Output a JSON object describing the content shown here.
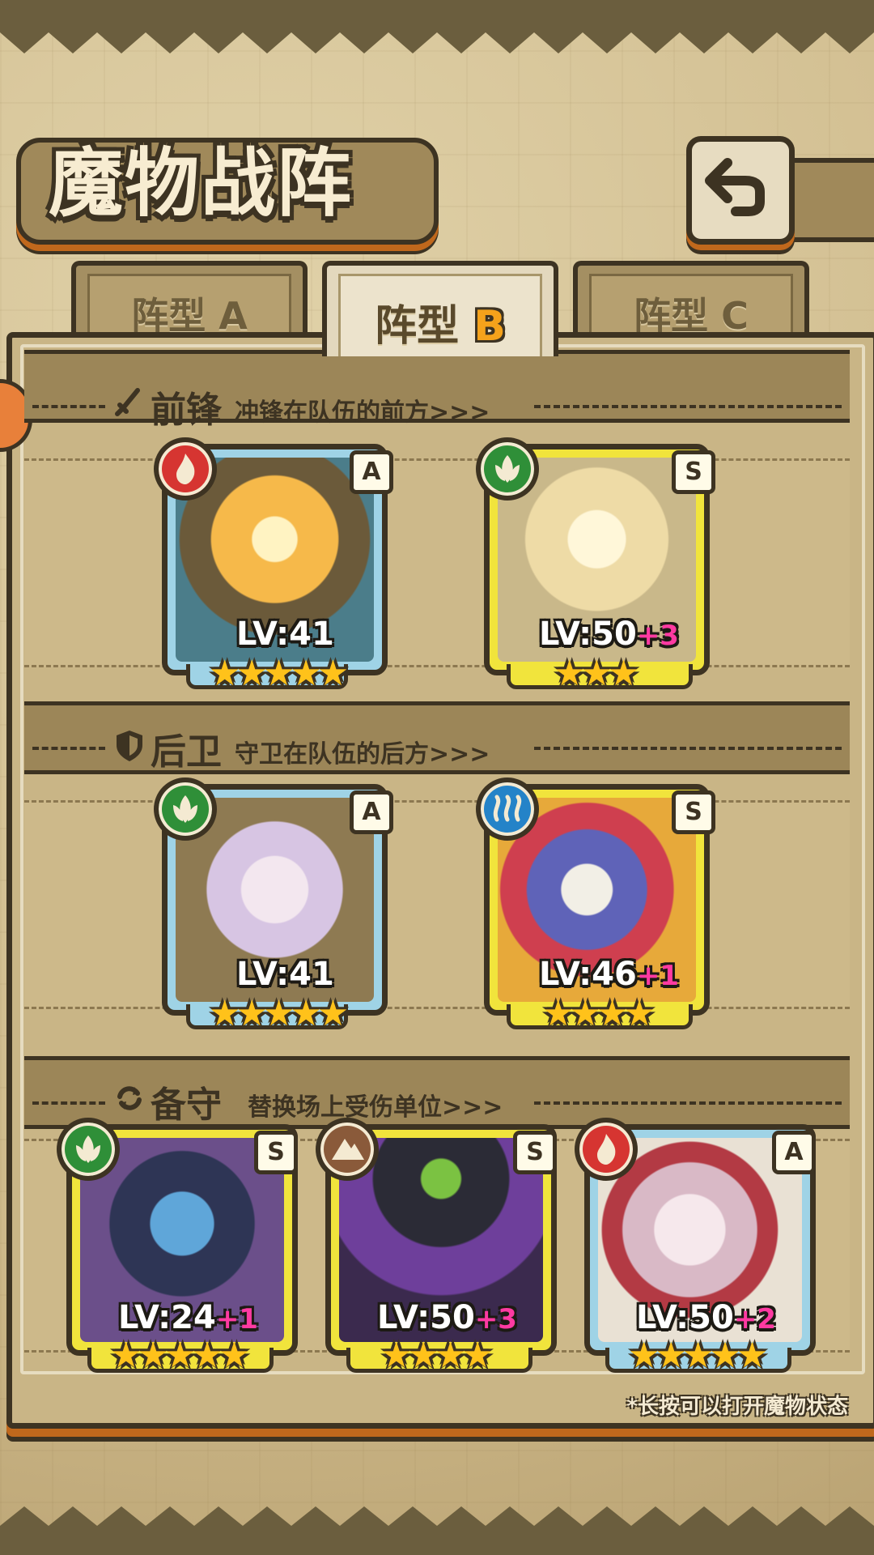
{
  "header": {
    "title": "魔物战阵"
  },
  "tabs": [
    {
      "label": "阵型",
      "letter": "A",
      "active": false
    },
    {
      "label": "阵型",
      "letter": "B",
      "active": true
    },
    {
      "label": "阵型",
      "letter": "C",
      "active": false
    }
  ],
  "sections": {
    "vanguard": {
      "title": "前锋",
      "subtitle": "冲锋在队伍的前方>>>"
    },
    "rearguard": {
      "title": "后卫",
      "subtitle": "守卫在队伍的后方>>>"
    },
    "reserve": {
      "title": "备守",
      "subtitle": "替换场上受伤单位>>>"
    }
  },
  "cards": {
    "v1": {
      "rank": "A",
      "element": "fire",
      "lv": "LV:41",
      "plus": "",
      "stars": "★★★★★"
    },
    "v2": {
      "rank": "S",
      "element": "wood",
      "lv": "LV:50",
      "plus": "+3",
      "stars": "★★★"
    },
    "r1": {
      "rank": "A",
      "element": "wood",
      "lv": "LV:41",
      "plus": "",
      "stars": "★★★★★"
    },
    "r2": {
      "rank": "S",
      "element": "water",
      "lv": "LV:46",
      "plus": "+1",
      "stars": "★★★★"
    },
    "b1": {
      "rank": "S",
      "element": "wood",
      "lv": "LV:24",
      "plus": "+1",
      "stars": "★★★★★"
    },
    "b2": {
      "rank": "S",
      "element": "earth",
      "lv": "LV:50",
      "plus": "+3",
      "stars": "★★★★"
    },
    "b3": {
      "rank": "A",
      "element": "fire",
      "lv": "LV:50",
      "plus": "+2",
      "stars": "★★★★★"
    }
  },
  "footer_note": "*长按可以打开魔物状态",
  "colors": {
    "outline": "#3d3322",
    "accent": "#c0681c",
    "plus": "#ff3aa2",
    "star": "#ffc21a"
  }
}
